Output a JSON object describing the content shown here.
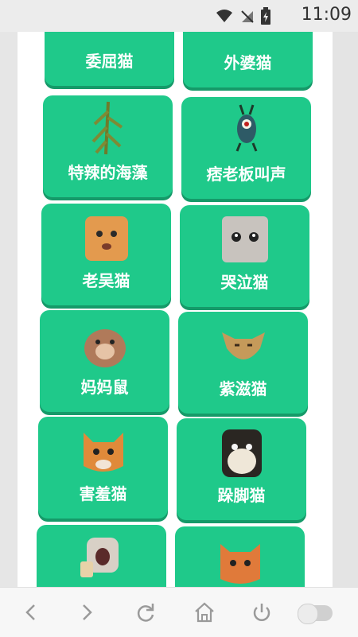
{
  "status_bar": {
    "time": "11:09"
  },
  "sounds": [
    {
      "label": "委屈猫",
      "icon": "cat-sad-photo"
    },
    {
      "label": "外婆猫",
      "icon": "cat-grandma-photo"
    },
    {
      "label": "特辣的海藻",
      "icon": "seaweed-photo"
    },
    {
      "label": "痞老板叫声",
      "icon": "plankton-photo"
    },
    {
      "label": "老吴猫",
      "icon": "cat-wu-photo"
    },
    {
      "label": "哭泣猫",
      "icon": "cat-crying-photo"
    },
    {
      "label": "妈妈鼠",
      "icon": "hamster-photo"
    },
    {
      "label": "紫滋猫",
      "icon": "cat-zizi-photo"
    },
    {
      "label": "害羞猫",
      "icon": "cat-shy-photo"
    },
    {
      "label": "跺脚猫",
      "icon": "cat-stomp-photo"
    },
    {
      "label": "",
      "icon": "cat-screaming-photo"
    },
    {
      "label": "",
      "icon": "cat-orange-photo"
    }
  ],
  "colors": {
    "card": "#1fc98a",
    "card_shadow": "#159a69",
    "label": "#ffffff"
  },
  "bottom_nav": [
    "back-icon",
    "forward-icon",
    "refresh-icon",
    "home-icon",
    "power-icon",
    "toggle"
  ]
}
